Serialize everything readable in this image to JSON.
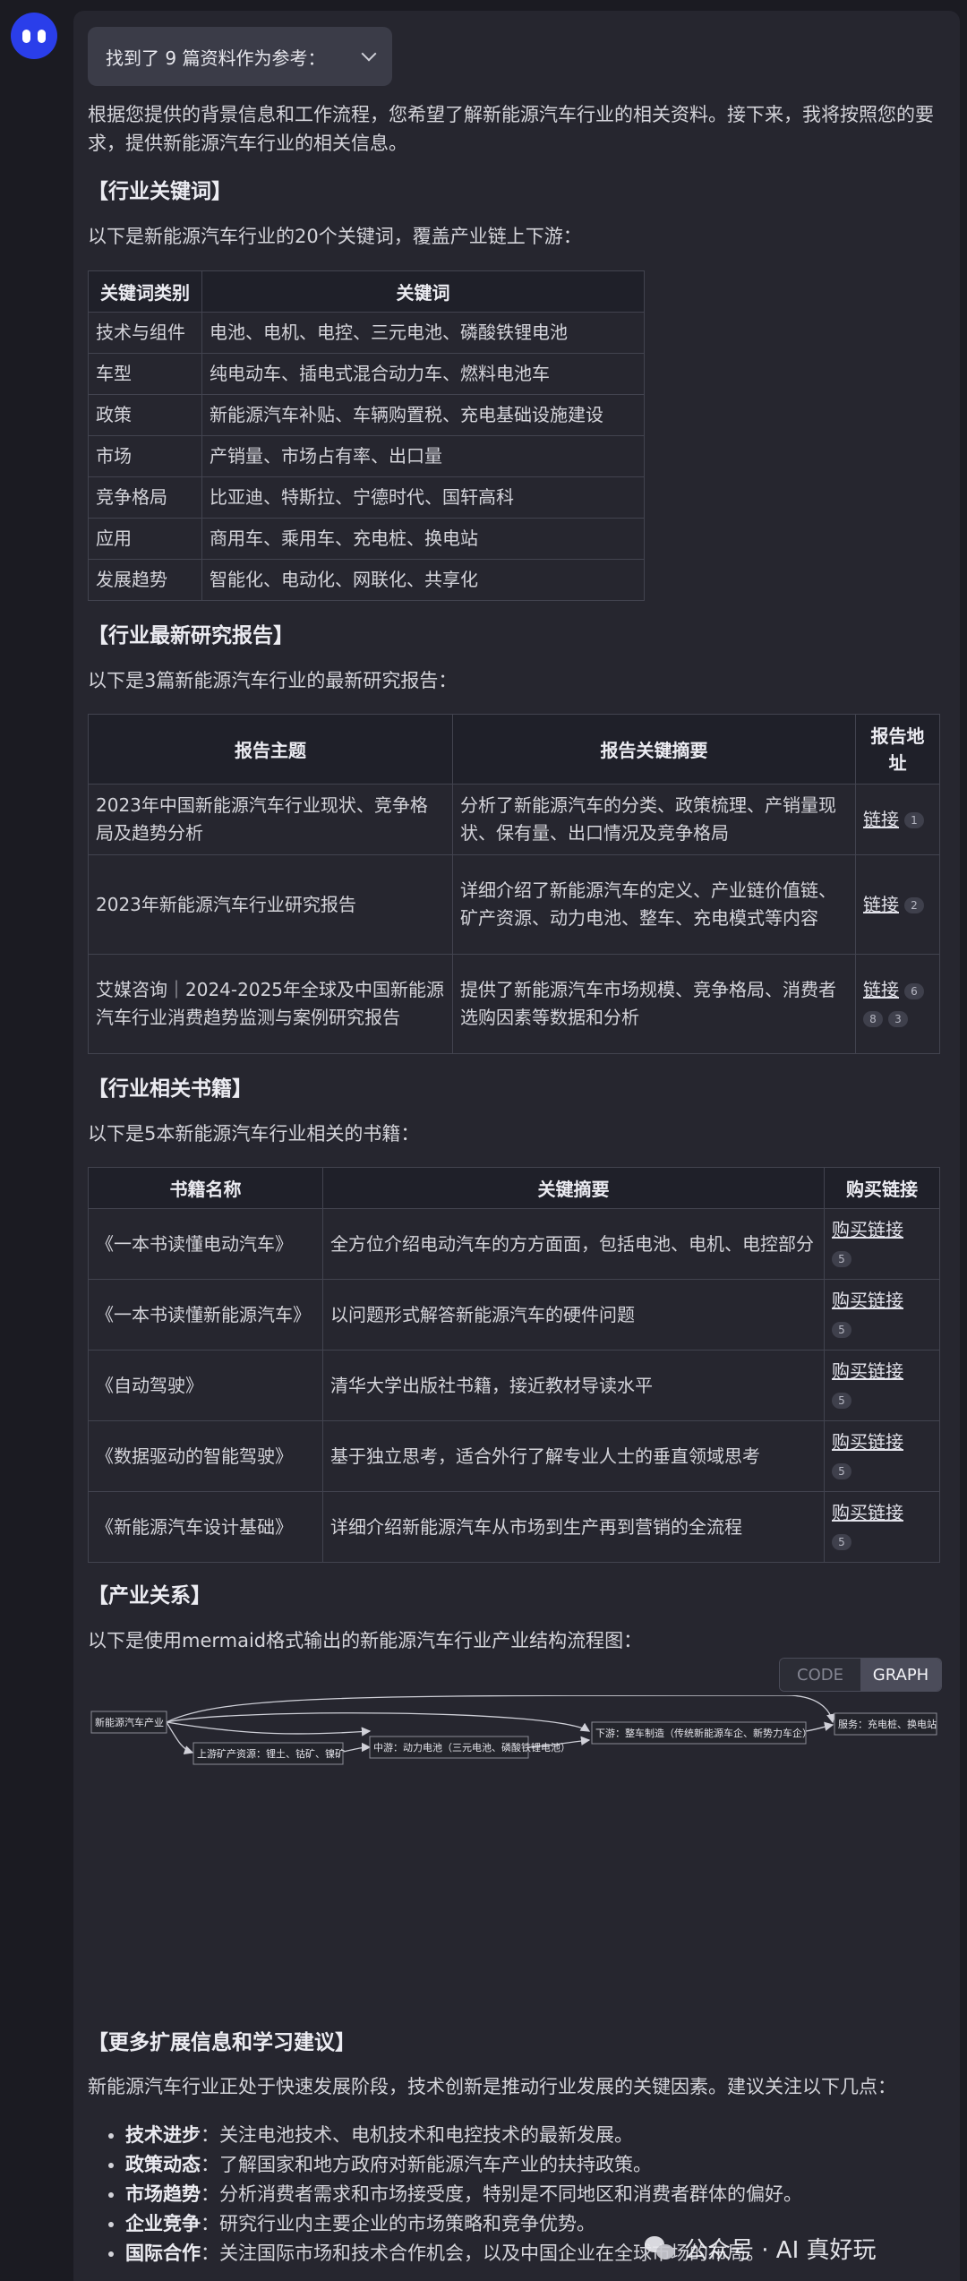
{
  "ref_button": {
    "label": "找到了 9 篇资料作为参考："
  },
  "intro": "根据您提供的背景信息和工作流程，您希望了解新能源汽车行业的相关资料。接下来，我将按照您的要求，提供新能源汽车行业的相关信息。",
  "keywords": {
    "title": "【行业关键词】",
    "desc": "以下是新能源汽车行业的20个关键词，覆盖产业链上下游：",
    "headers": [
      "关键词类别",
      "关键词"
    ],
    "rows": [
      [
        "技术与组件",
        "电池、电机、电控、三元电池、磷酸铁锂电池"
      ],
      [
        "车型",
        "纯电动车、插电式混合动力车、燃料电池车"
      ],
      [
        "政策",
        "新能源汽车补贴、车辆购置税、充电基础设施建设"
      ],
      [
        "市场",
        "产销量、市场占有率、出口量"
      ],
      [
        "竞争格局",
        "比亚迪、特斯拉、宁德时代、国轩高科"
      ],
      [
        "应用",
        "商用车、乘用车、充电桩、换电站"
      ],
      [
        "发展趋势",
        "智能化、电动化、网联化、共享化"
      ]
    ]
  },
  "reports": {
    "title": "【行业最新研究报告】",
    "desc": "以下是3篇新能源汽车行业的最新研究报告：",
    "headers": [
      "报告主题",
      "报告关键摘要",
      "报告地址"
    ],
    "rows": [
      {
        "topic": "2023年中国新能源汽车行业现状、竞争格局及趋势分析",
        "summary": "分析了新能源汽车的分类、政策梳理、产销量现状、保有量、出口情况及竞争格局",
        "link": "链接",
        "refs": [
          "1"
        ]
      },
      {
        "topic": "2023年新能源汽车行业研究报告",
        "summary": "详细介绍了新能源汽车的定义、产业链价值链、矿产资源、动力电池、整车、充电模式等内容",
        "link": "链接",
        "refs": [
          "2"
        ]
      },
      {
        "topic": "艾媒咨询｜2024-2025年全球及中国新能源汽车行业消费趋势监测与案例研究报告",
        "summary": "提供了新能源汽车市场规模、竞争格局、消费者选购因素等数据和分析",
        "link": "链接",
        "refs": [
          "6",
          "8",
          "3"
        ]
      }
    ]
  },
  "books": {
    "title": "【行业相关书籍】",
    "desc": "以下是5本新能源汽车行业相关的书籍：",
    "headers": [
      "书籍名称",
      "关键摘要",
      "购买链接"
    ],
    "rows": [
      {
        "name": "《一本书读懂电动汽车》",
        "summary": "全方位介绍电动汽车的方方面面，包括电池、电机、电控部分",
        "link": "购买链接",
        "ref": "5"
      },
      {
        "name": "《一本书读懂新能源汽车》",
        "summary": "以问题形式解答新能源汽车的硬件问题",
        "link": "购买链接",
        "ref": "5"
      },
      {
        "name": "《自动驾驶》",
        "summary": "清华大学出版社书籍，接近教材导读水平",
        "link": "购买链接",
        "ref": "5"
      },
      {
        "name": "《数据驱动的智能驾驶》",
        "summary": "基于独立思考，适合外行了解专业人士的垂直领域思考",
        "link": "购买链接",
        "ref": "5"
      },
      {
        "name": "《新能源汽车设计基础》",
        "summary": "详细介绍新能源汽车从市场到生产再到营销的全流程",
        "link": "购买链接",
        "ref": "5"
      }
    ]
  },
  "industry": {
    "title": "【产业关系】",
    "desc": "以下是使用mermaid格式输出的新能源汽车行业产业结构流程图：",
    "tabs": {
      "code": "CODE",
      "graph": "GRAPH"
    },
    "nodes": {
      "root": "新能源汽车产业",
      "upstream": "上游矿产资源：锂土、钴矿、镍矿",
      "midstream": "中游：动力电池（三元电池、磷酸铁锂电池）",
      "downstream": "下游：整车制造（传统新能源车企、新势力车企）",
      "service": "服务：充电桩、换电站"
    }
  },
  "more": {
    "title": "【更多扩展信息和学习建议】",
    "desc": "新能源汽车行业正处于快速发展阶段，技术创新是推动行业发展的关键因素。建议关注以下几点：",
    "tips": [
      {
        "label": "技术进步",
        "text": "：关注电池技术、电机技术和电控技术的最新发展。"
      },
      {
        "label": "政策动态",
        "text": "：了解国家和地方政府对新能源汽车产业的扶持政策。"
      },
      {
        "label": "市场趋势",
        "text": "：分析消费者需求和市场接受度，特别是不同地区和消费者群体的偏好。"
      },
      {
        "label": "企业竞争",
        "text": "：研究行业内主要企业的市场策略和竞争优势。"
      },
      {
        "label": "国际合作",
        "text": "：关注国际市场和技术合作机会，以及中国企业在全球市场的布局。"
      }
    ]
  },
  "watermark": "公众号 · AI 真好玩"
}
